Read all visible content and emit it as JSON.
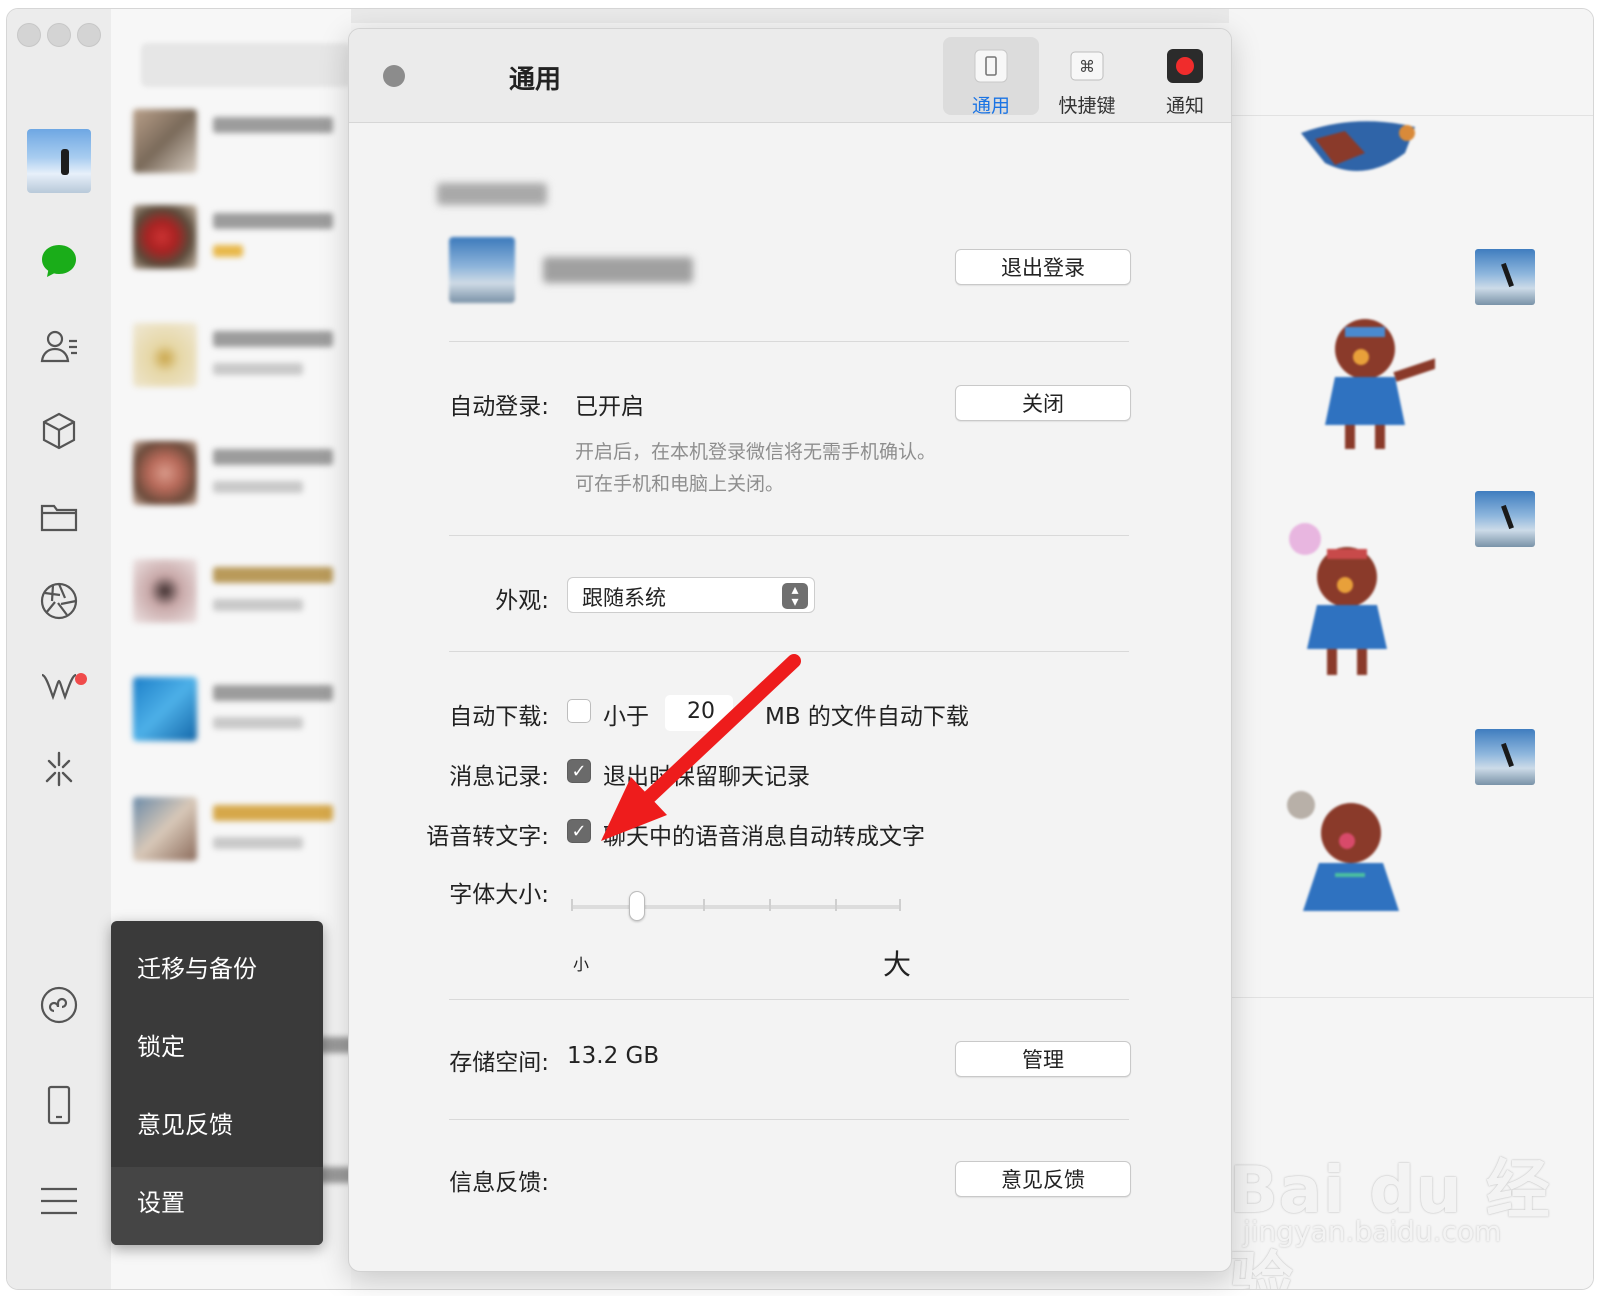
{
  "settings": {
    "title": "通用",
    "tabs": [
      {
        "label": "通用",
        "icon": "phone-icon",
        "active": true
      },
      {
        "label": "快捷键",
        "icon": "command-key-icon",
        "active": false
      },
      {
        "label": "通知",
        "icon": "red-dot-icon",
        "active": false
      }
    ],
    "logout_button": "退出登录",
    "auto_login": {
      "label": "自动登录:",
      "value": "已开启",
      "button": "关闭",
      "hint_line1": "开启后，在本机登录微信将无需手机确认。",
      "hint_line2": "可在手机和电脑上关闭。"
    },
    "appearance": {
      "label": "外观:",
      "selected": "跟随系统"
    },
    "auto_download": {
      "label": "自动下载:",
      "checked": false,
      "prefix": "小于",
      "size": "20",
      "suffix": "MB 的文件自动下载"
    },
    "message_history": {
      "label": "消息记录:",
      "checked": true,
      "text": "退出时保留聊天记录"
    },
    "voice_to_text": {
      "label": "语音转文字:",
      "checked": true,
      "text": "聊天中的语音消息自动转成文字"
    },
    "font_size": {
      "label": "字体大小:",
      "min_label": "小",
      "max_label": "大",
      "level": 1,
      "levels": 6
    },
    "storage": {
      "label": "存储空间:",
      "value": "13.2 GB",
      "button": "管理"
    },
    "feedback": {
      "label": "信息反馈:",
      "button": "意见反馈"
    }
  },
  "popup_menu": {
    "items": [
      "迁移与备份",
      "锁定",
      "意见反馈",
      "设置"
    ]
  },
  "sidebar": {
    "icons": [
      "chat-icon",
      "contacts-icon",
      "favorites-cube-icon",
      "folder-icon",
      "moments-aperture-icon",
      "channels-icon",
      "search-sparkle-icon",
      "mini-programs-icon",
      "phone-device-icon",
      "menu-icon"
    ]
  },
  "watermark": {
    "logo": "Bai du 经验",
    "url": "jingyan.baidu.com"
  },
  "colors": {
    "accent_blue": "#1b74e4",
    "wechat_green": "#1aad19",
    "arrow_red": "#ee1c1c",
    "menu_bg": "#3a3a3a"
  }
}
